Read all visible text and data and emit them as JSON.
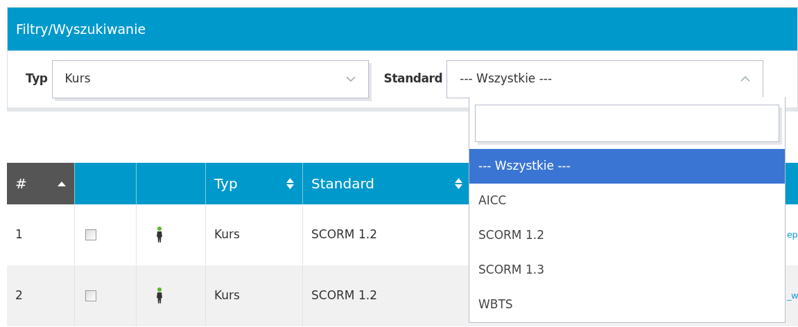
{
  "panel": {
    "title": "Filtry/Wyszukiwanie"
  },
  "filters": [
    {
      "label": "Typ",
      "value": "Kurs",
      "expanded": false
    },
    {
      "label": "Standard",
      "value": "--- Wszystkie ---",
      "expanded": true
    }
  ],
  "dropdown": {
    "options": [
      {
        "label": "--- Wszystkie ---",
        "selected": true
      },
      {
        "label": "AICC",
        "selected": false
      },
      {
        "label": "SCORM 1.2",
        "selected": false
      },
      {
        "label": "SCORM 1.3",
        "selected": false
      },
      {
        "label": "WBTS",
        "selected": false
      }
    ]
  },
  "table": {
    "columns": [
      {
        "label": "#",
        "sorted": true
      },
      {
        "sorted": false
      },
      {
        "sorted": false
      },
      {
        "label": "Typ",
        "sorted": false
      },
      {
        "label": "Standard",
        "sorted": false
      }
    ],
    "rows": [
      {
        "number": "1",
        "checked": false,
        "type": "Kurs",
        "standard": "SCORM 1.2",
        "column_6": "ep"
      },
      {
        "number": "2",
        "checked": false,
        "type": "Kurs",
        "standard": "SCORM 1.2",
        "column_6": "_w"
      }
    ]
  }
}
